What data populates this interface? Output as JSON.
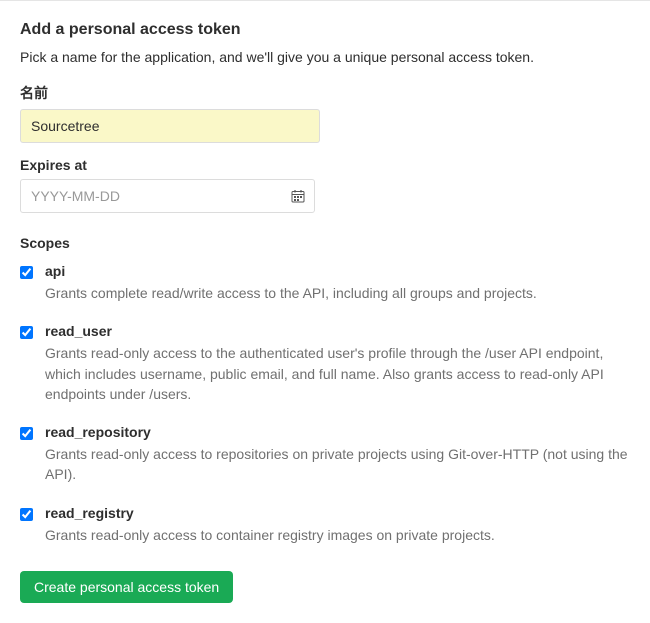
{
  "header": {
    "title": "Add a personal access token",
    "subtitle": "Pick a name for the application, and we'll give you a unique personal access token."
  },
  "name_field": {
    "label": "名前",
    "value": "Sourcetree"
  },
  "expires_field": {
    "label": "Expires at",
    "placeholder": "YYYY-MM-DD",
    "value": ""
  },
  "scopes": {
    "label": "Scopes",
    "items": [
      {
        "name": "api",
        "desc": "Grants complete read/write access to the API, including all groups and projects.",
        "checked": true
      },
      {
        "name": "read_user",
        "desc": "Grants read-only access to the authenticated user's profile through the /user API endpoint, which includes username, public email, and full name. Also grants access to read-only API endpoints under /users.",
        "checked": true
      },
      {
        "name": "read_repository",
        "desc": "Grants read-only access to repositories on private projects using Git-over-HTTP (not using the API).",
        "checked": true
      },
      {
        "name": "read_registry",
        "desc": "Grants read-only access to container registry images on private projects.",
        "checked": true
      }
    ]
  },
  "submit": {
    "label": "Create personal access token"
  }
}
